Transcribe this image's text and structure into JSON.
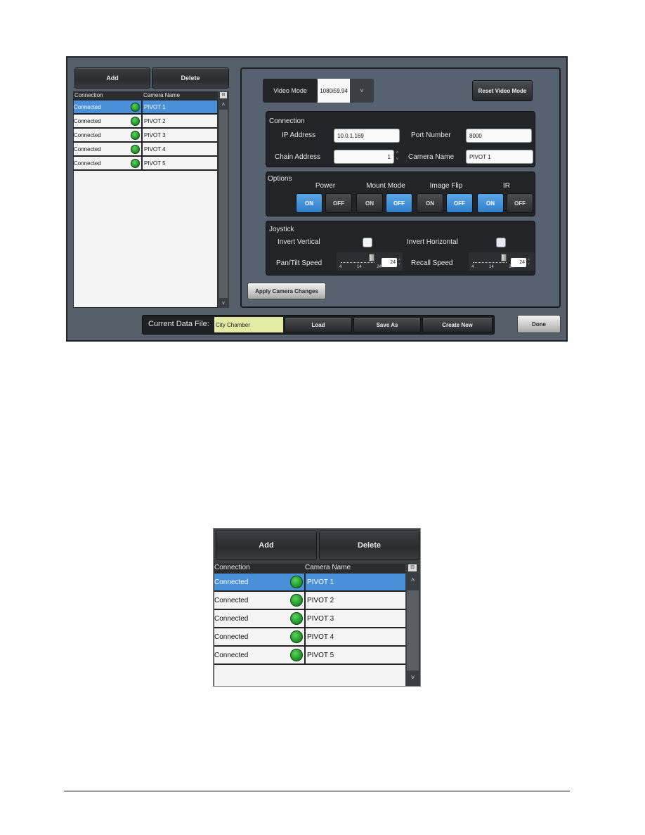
{
  "camera_list": {
    "add_label": "Add",
    "delete_label": "Delete",
    "columns": [
      "Connection",
      "Camera Name"
    ],
    "rows": [
      {
        "connection": "Connected",
        "name": "PIVOT 1",
        "selected": true
      },
      {
        "connection": "Connected",
        "name": "PIVOT 2",
        "selected": false
      },
      {
        "connection": "Connected",
        "name": "PIVOT 3",
        "selected": false
      },
      {
        "connection": "Connected",
        "name": "PIVOT 4",
        "selected": false
      },
      {
        "connection": "Connected",
        "name": "PIVOT 5",
        "selected": false
      }
    ],
    "status_icon": "green-dot-icon",
    "column_chooser_icon": "column-chooser-icon",
    "scroll_up_glyph": "˄",
    "scroll_down_glyph": "˅"
  },
  "video_mode": {
    "label": "Video Mode",
    "value": "1080i59.94",
    "dropdown_glyph": "˅",
    "reset_label": "Reset Video Mode"
  },
  "connection": {
    "title": "Connection",
    "ip_label": "IP Address",
    "ip_value": "10.0.1.169",
    "port_label": "Port Number",
    "port_value": "8000",
    "chain_label": "Chain Address",
    "chain_value": "1",
    "camera_name_label": "Camera Name",
    "camera_name_value": "PIVOT 1"
  },
  "options": {
    "title": "Options",
    "on_label": "ON",
    "off_label": "OFF",
    "groups": [
      {
        "label": "Power",
        "state": "ON"
      },
      {
        "label": "Mount Mode",
        "state": "OFF"
      },
      {
        "label": "Image Flip",
        "state": "OFF"
      },
      {
        "label": "IR",
        "state": "ON"
      }
    ]
  },
  "joystick": {
    "title": "Joystick",
    "invert_vertical_label": "Invert Vertical",
    "invert_vertical_checked": false,
    "invert_horizontal_label": "Invert Horizontal",
    "invert_horizontal_checked": false,
    "pan_tilt_label": "Pan/Tilt Speed",
    "pan_tilt_value": "24",
    "recall_label": "Recall Speed",
    "recall_value": "24",
    "slider_ticks": [
      "4",
      "14",
      "24"
    ],
    "slider_min": 1,
    "slider_max": 24
  },
  "apply_label": "Apply Camera Changes",
  "data_file": {
    "label": "Current Data File:",
    "value": "City Chamber",
    "load_label": "Load",
    "save_as_label": "Save As",
    "create_new_label": "Create New"
  },
  "done_label": "Done",
  "colors": {
    "selected_row": "#4a90d9",
    "toggle_on": "#3a8ad6",
    "status_green": "#2aa234",
    "data_file_bg": "#e3eba5",
    "window_bg": "#555f6a"
  }
}
